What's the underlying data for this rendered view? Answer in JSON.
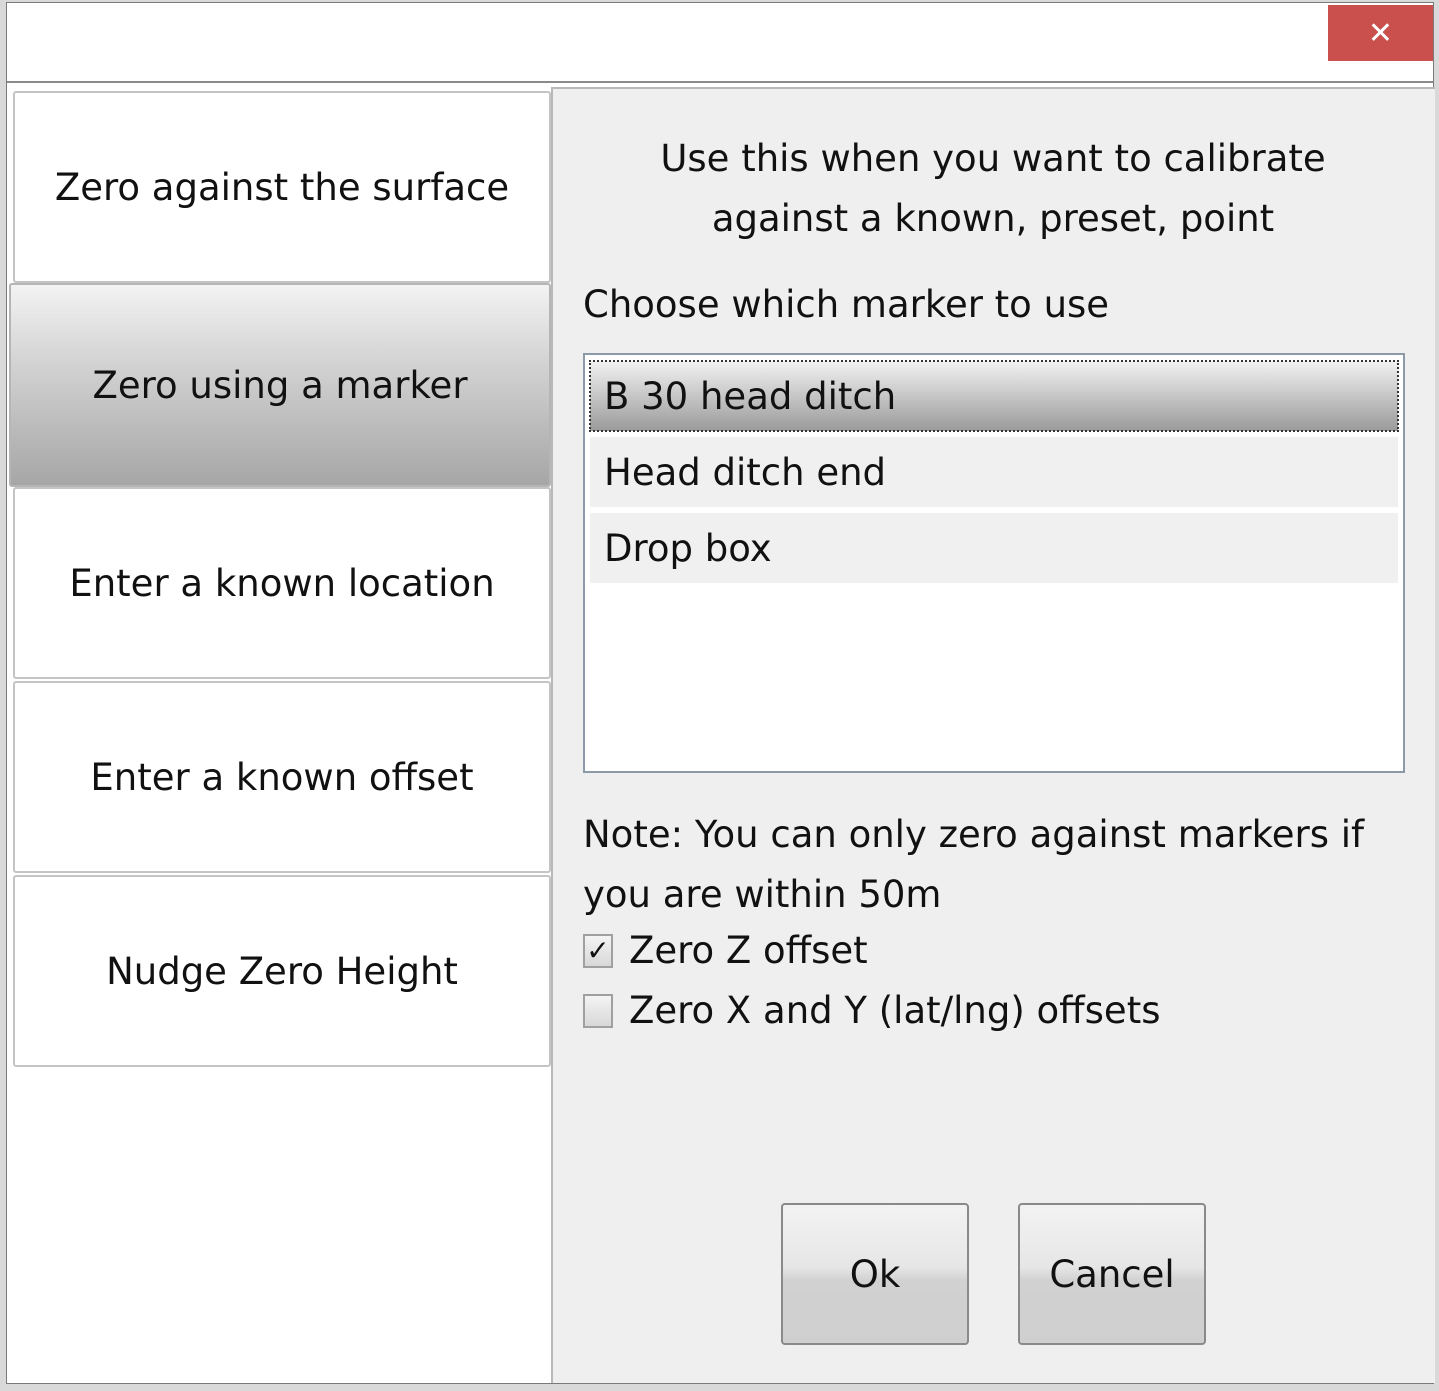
{
  "window": {
    "close_glyph": "✕",
    "close_color": "#c9504d"
  },
  "sidebar": {
    "items": [
      {
        "label": "Zero against the surface",
        "selected": false
      },
      {
        "label": "Zero using a marker",
        "selected": true
      },
      {
        "label": "Enter a known location",
        "selected": false
      },
      {
        "label": "Enter a known offset",
        "selected": false
      },
      {
        "label": "Nudge Zero Height",
        "selected": false
      }
    ]
  },
  "panel": {
    "description": "Use this when you want to calibrate against a known, preset, point",
    "prompt": "Choose which marker to use",
    "markers": [
      {
        "label": "B 30 head ditch",
        "selected": true
      },
      {
        "label": "Head ditch end",
        "selected": false
      },
      {
        "label": "Drop box",
        "selected": false
      }
    ],
    "note": "Note: You can only zero against markers if you are within 50m",
    "options": [
      {
        "label": "Zero Z offset",
        "checked": true,
        "glyph": "✓"
      },
      {
        "label": "Zero X and Y (lat/lng) offsets",
        "checked": false,
        "glyph": ""
      }
    ]
  },
  "buttons": {
    "ok_label": "Ok",
    "cancel_label": "Cancel"
  }
}
